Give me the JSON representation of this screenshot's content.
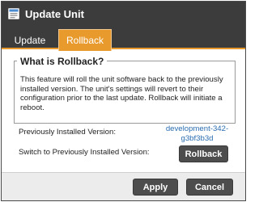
{
  "dialog": {
    "title": "Update Unit",
    "icon": "update-window-icon"
  },
  "tabs": [
    {
      "label": "Update",
      "active": false
    },
    {
      "label": "Rollback",
      "active": true
    }
  ],
  "rollback": {
    "heading": "What is Rollback?",
    "description": "This feature will roll the unit software back to the previously installed version. The unit's settings will revert to their configuration prior to the last update. Rollback will initiate a reboot.",
    "previous_version_label": "Previously Installed Version:",
    "previous_version_value": "development-342-g3bf3b3d",
    "switch_label": "Switch to Previously Installed Version:",
    "rollback_button": "Rollback"
  },
  "footer": {
    "apply_label": "Apply",
    "cancel_label": "Cancel"
  },
  "colors": {
    "titlebar": "#3c3c3c",
    "accent": "#e99a2c",
    "link": "#2a6db0",
    "button": "#4d4d4d"
  }
}
